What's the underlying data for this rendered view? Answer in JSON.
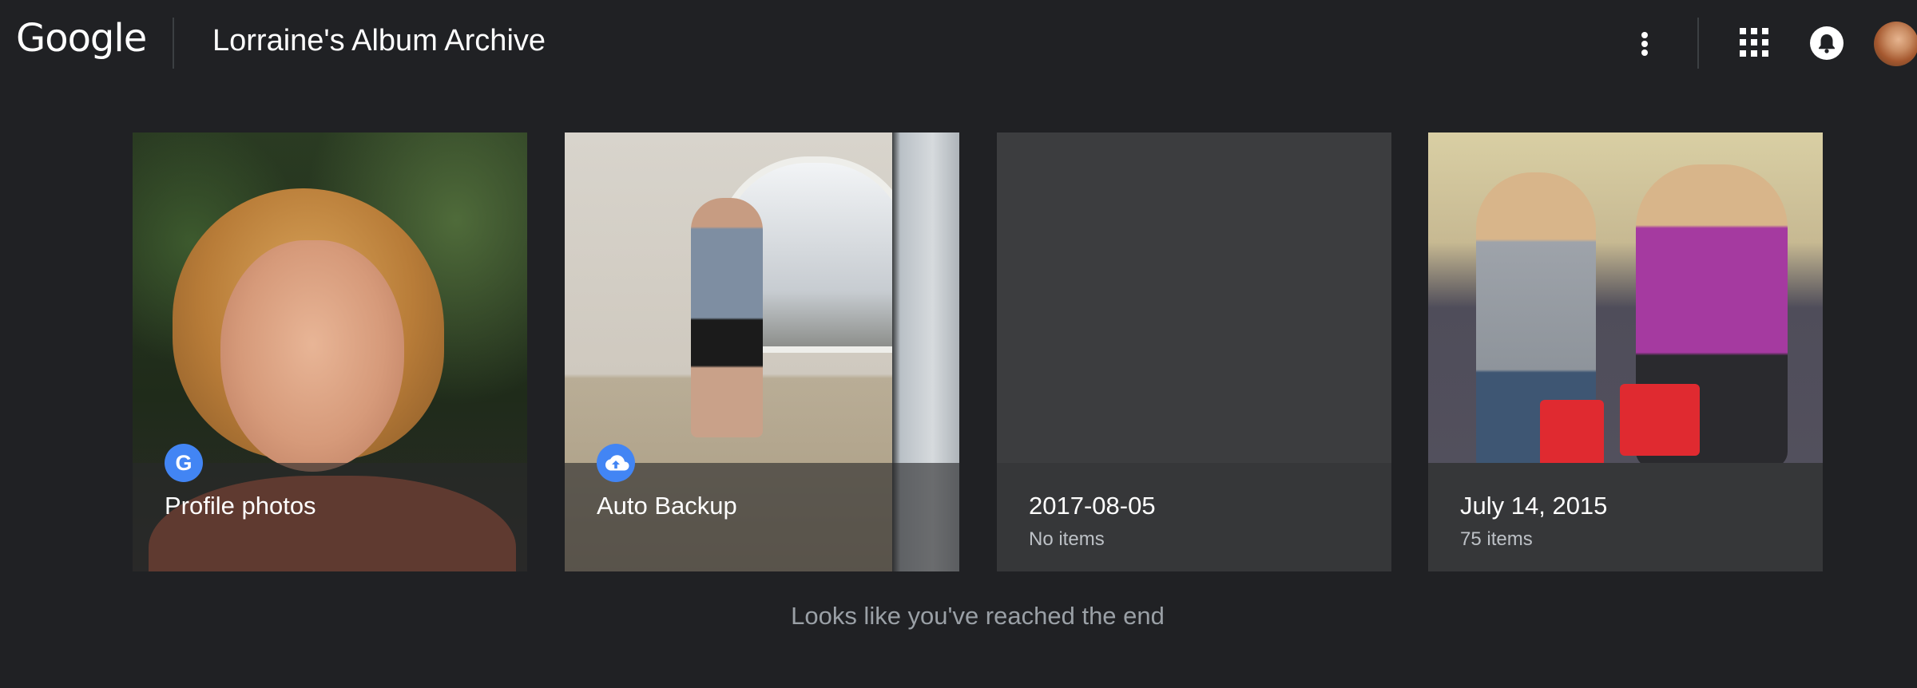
{
  "header": {
    "logo": "Google",
    "title": "Lorraine's Album Archive",
    "more_icon": "more-vert-icon",
    "apps_icon": "apps-grid-icon",
    "notifications_icon": "bell-icon"
  },
  "albums": [
    {
      "title": "Profile photos",
      "count": "",
      "source_icon": "google-g-icon",
      "source_glyph": "G"
    },
    {
      "title": "Auto Backup",
      "count": "",
      "source_icon": "cloud-upload-icon",
      "source_glyph": ""
    },
    {
      "title": "2017-08-05",
      "count": "No items"
    },
    {
      "title": "July 14, 2015",
      "count": "75 items"
    }
  ],
  "end_message": "Looks like you've reached the end",
  "colors": {
    "background": "#202124",
    "card_footer": "#363739",
    "accent_blue": "#4285f4",
    "muted_text": "#9aa0a6"
  }
}
